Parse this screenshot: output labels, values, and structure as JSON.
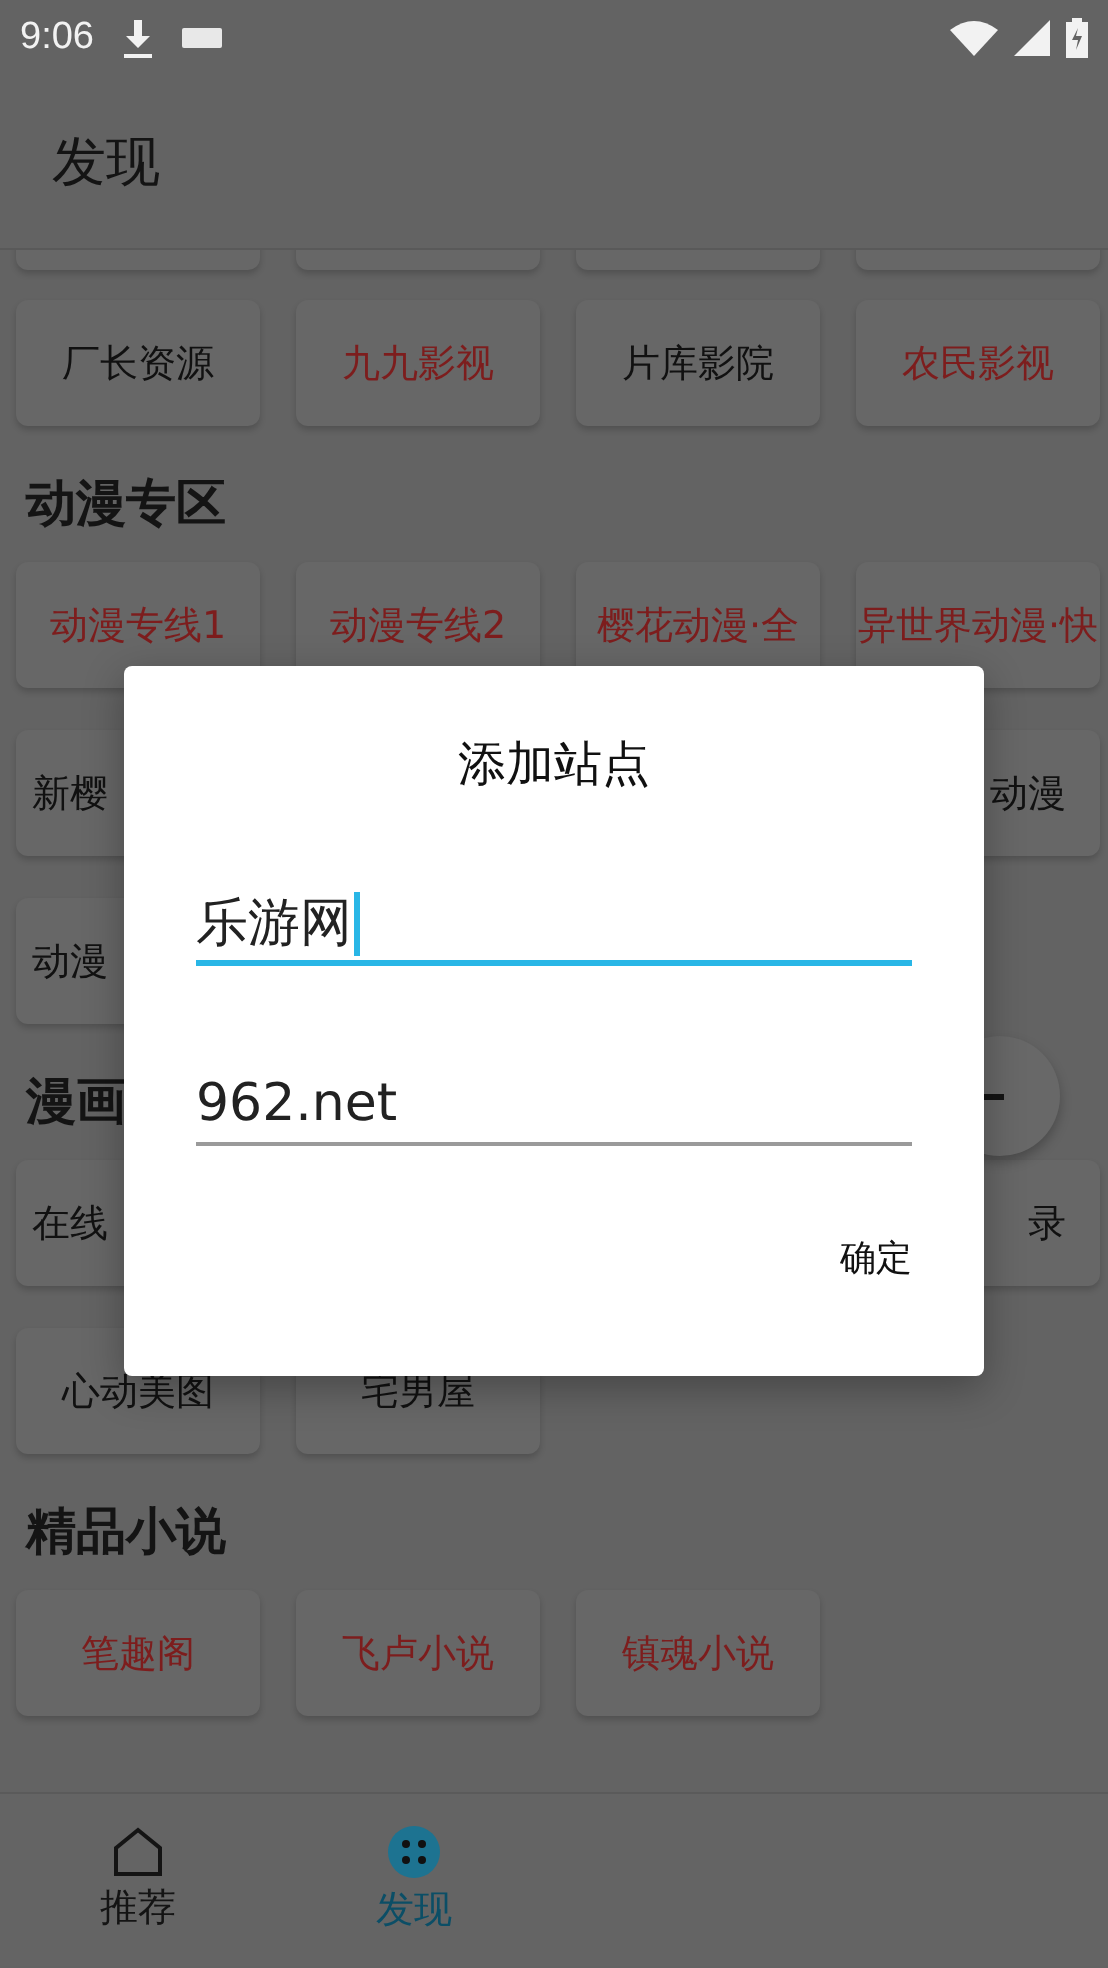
{
  "status_bar": {
    "time": "9:06"
  },
  "app_bar": {
    "title": "发现"
  },
  "sections": [
    {
      "rows": [
        {
          "chips": [
            {
              "label": "厂长资源",
              "color": "#111111"
            },
            {
              "label": "九九影视",
              "color": "#7d1d1d"
            },
            {
              "label": "片库影院",
              "color": "#111111"
            },
            {
              "label": "农民影视",
              "color": "#7d1d1d"
            }
          ]
        }
      ]
    },
    {
      "title": "动漫专区",
      "rows": [
        {
          "chips": [
            {
              "label": "动漫专线1",
              "color": "#7d1d1d"
            },
            {
              "label": "动漫专线2",
              "color": "#7d1d1d"
            },
            {
              "label": "樱花动漫·全",
              "color": "#7d1d1d"
            },
            {
              "label": "异世界动漫·快",
              "color": "#7d1d1d"
            }
          ]
        },
        {
          "left": {
            "label": "新樱",
            "color": "#111111"
          },
          "right": {
            "label": "动漫",
            "color": "#111111"
          }
        },
        {
          "left": {
            "label": "动漫",
            "color": "#111111"
          }
        }
      ]
    },
    {
      "title": "漫画",
      "rows": [
        {
          "left": {
            "label": "在线",
            "color": "#111111"
          },
          "right": {
            "label": "录",
            "color": "#111111"
          }
        },
        {
          "chips": [
            {
              "label": "心动美图",
              "color": "#111111"
            },
            {
              "label": "宅男屋",
              "color": "#111111"
            }
          ]
        }
      ]
    },
    {
      "title": "精品小说",
      "rows": [
        {
          "chips": [
            {
              "label": "笔趣阁",
              "color": "#7d1d1d"
            },
            {
              "label": "飞卢小说",
              "color": "#7d1d1d"
            },
            {
              "label": "镇魂小说",
              "color": "#7d1d1d"
            }
          ]
        }
      ]
    }
  ],
  "bottom_nav": [
    {
      "label": "推荐",
      "selected": false
    },
    {
      "label": "发现",
      "selected": true
    }
  ],
  "dialog": {
    "title": "添加站点",
    "fields": [
      {
        "value": "乐游网",
        "focused": true
      },
      {
        "value": "962.net",
        "focused": false
      }
    ],
    "button": "确定"
  }
}
